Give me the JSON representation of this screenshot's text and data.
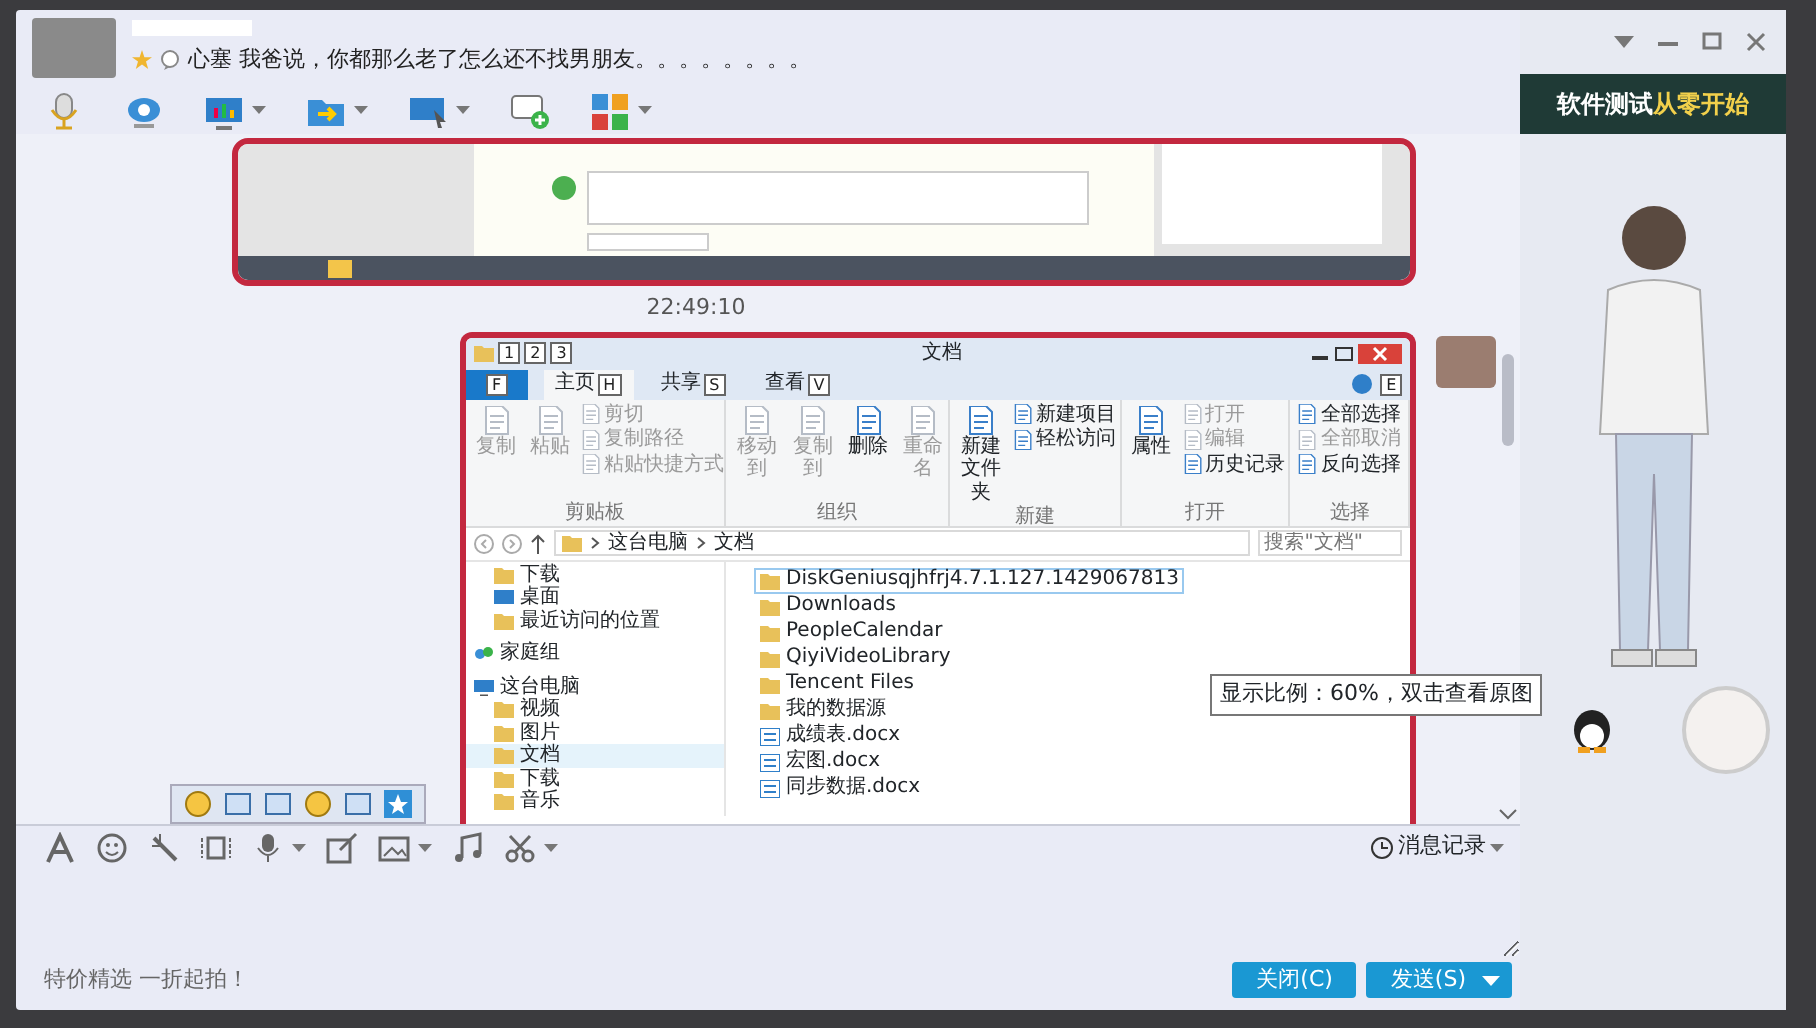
{
  "contact": {
    "status_text": "心塞 我爸说，你都那么老了怎么还不找男朋友。。。。。。。。"
  },
  "banner": {
    "text": "软件测试",
    "highlight": "从零开始"
  },
  "chat": {
    "time": "22:49:10",
    "tooltip": "显示比例：60%，双击查看原图",
    "explorer": {
      "title": "文档",
      "quick_access_keys": [
        "1",
        "2",
        "3"
      ],
      "file_tab_key": "F",
      "help_key": "E",
      "tabs": [
        {
          "label": "主页",
          "key": "H",
          "selected": true
        },
        {
          "label": "共享",
          "key": "S",
          "selected": false
        },
        {
          "label": "查看",
          "key": "V",
          "selected": false
        }
      ],
      "ribbon": [
        {
          "label": "剪贴板",
          "large": [
            {
              "label": "复制",
              "disabled": true
            },
            {
              "label": "粘贴",
              "disabled": true
            }
          ],
          "small": [
            {
              "label": "剪切",
              "disabled": true
            },
            {
              "label": "复制路径",
              "disabled": true
            },
            {
              "label": "粘贴快捷方式",
              "disabled": true
            }
          ]
        },
        {
          "label": "组织",
          "large": [
            {
              "label": "移动到",
              "disabled": true
            },
            {
              "label": "复制到",
              "disabled": true
            },
            {
              "label": "删除",
              "disabled": false
            },
            {
              "label": "重命名",
              "disabled": true
            }
          ]
        },
        {
          "label": "新建",
          "large": [
            {
              "label": "新建文件夹",
              "disabled": false
            }
          ],
          "small": [
            {
              "label": "新建项目",
              "disabled": false
            },
            {
              "label": "轻松访问",
              "disabled": false
            }
          ]
        },
        {
          "label": "打开",
          "large": [
            {
              "label": "属性",
              "disabled": false
            }
          ],
          "small": [
            {
              "label": "打开",
              "disabled": true
            },
            {
              "label": "编辑",
              "disabled": true
            },
            {
              "label": "历史记录",
              "disabled": false
            }
          ]
        },
        {
          "label": "选择",
          "small": [
            {
              "label": "全部选择",
              "disabled": false
            },
            {
              "label": "全部取消",
              "disabled": true
            },
            {
              "label": "反向选择",
              "disabled": false
            }
          ]
        }
      ],
      "address": [
        "这台电脑",
        "文档"
      ],
      "search": {
        "placeholder": "搜索\"文档\""
      },
      "nav": {
        "favorites": [
          {
            "label": "下载",
            "kind": "folder",
            "selected": false
          },
          {
            "label": "桌面",
            "kind": "desktop",
            "selected": false
          },
          {
            "label": "最近访问的位置",
            "kind": "folder",
            "selected": false
          }
        ],
        "groups": [
          {
            "label": "家庭组",
            "kind": "network",
            "selected": false
          },
          {
            "label": "这台电脑",
            "kind": "computer",
            "selected": false,
            "children": [
              {
                "label": "视频",
                "kind": "folder",
                "selected": false
              },
              {
                "label": "图片",
                "kind": "folder",
                "selected": false
              },
              {
                "label": "文档",
                "kind": "folder",
                "selected": true
              },
              {
                "label": "下载",
                "kind": "folder",
                "selected": false
              },
              {
                "label": "音乐",
                "kind": "folder",
                "selected": false
              }
            ]
          }
        ]
      },
      "files": [
        {
          "name": "DiskGeniusqjhfrj4.7.1.127.1429067813",
          "kind": "folder",
          "selected": true
        },
        {
          "name": "Downloads",
          "kind": "folder",
          "selected": false
        },
        {
          "name": "PeopleCalendar",
          "kind": "folder",
          "selected": false
        },
        {
          "name": "QiyiVideoLibrary",
          "kind": "folder",
          "selected": false
        },
        {
          "name": "Tencent Files",
          "kind": "folder",
          "selected": false
        },
        {
          "name": "我的数据源",
          "kind": "folder",
          "selected": false
        },
        {
          "name": "成绩表.docx",
          "kind": "document",
          "selected": false
        },
        {
          "name": "宏图.docx",
          "kind": "document",
          "selected": false
        },
        {
          "name": "同步数据.docx",
          "kind": "document",
          "selected": false
        }
      ]
    }
  },
  "input": {
    "history": "消息记录"
  },
  "footer": {
    "ad": "特价精选 一折起拍！",
    "buttons": [
      {
        "label": "关闭(C)",
        "kind": "plain"
      },
      {
        "label": "发送(S)",
        "kind": "split"
      }
    ]
  }
}
